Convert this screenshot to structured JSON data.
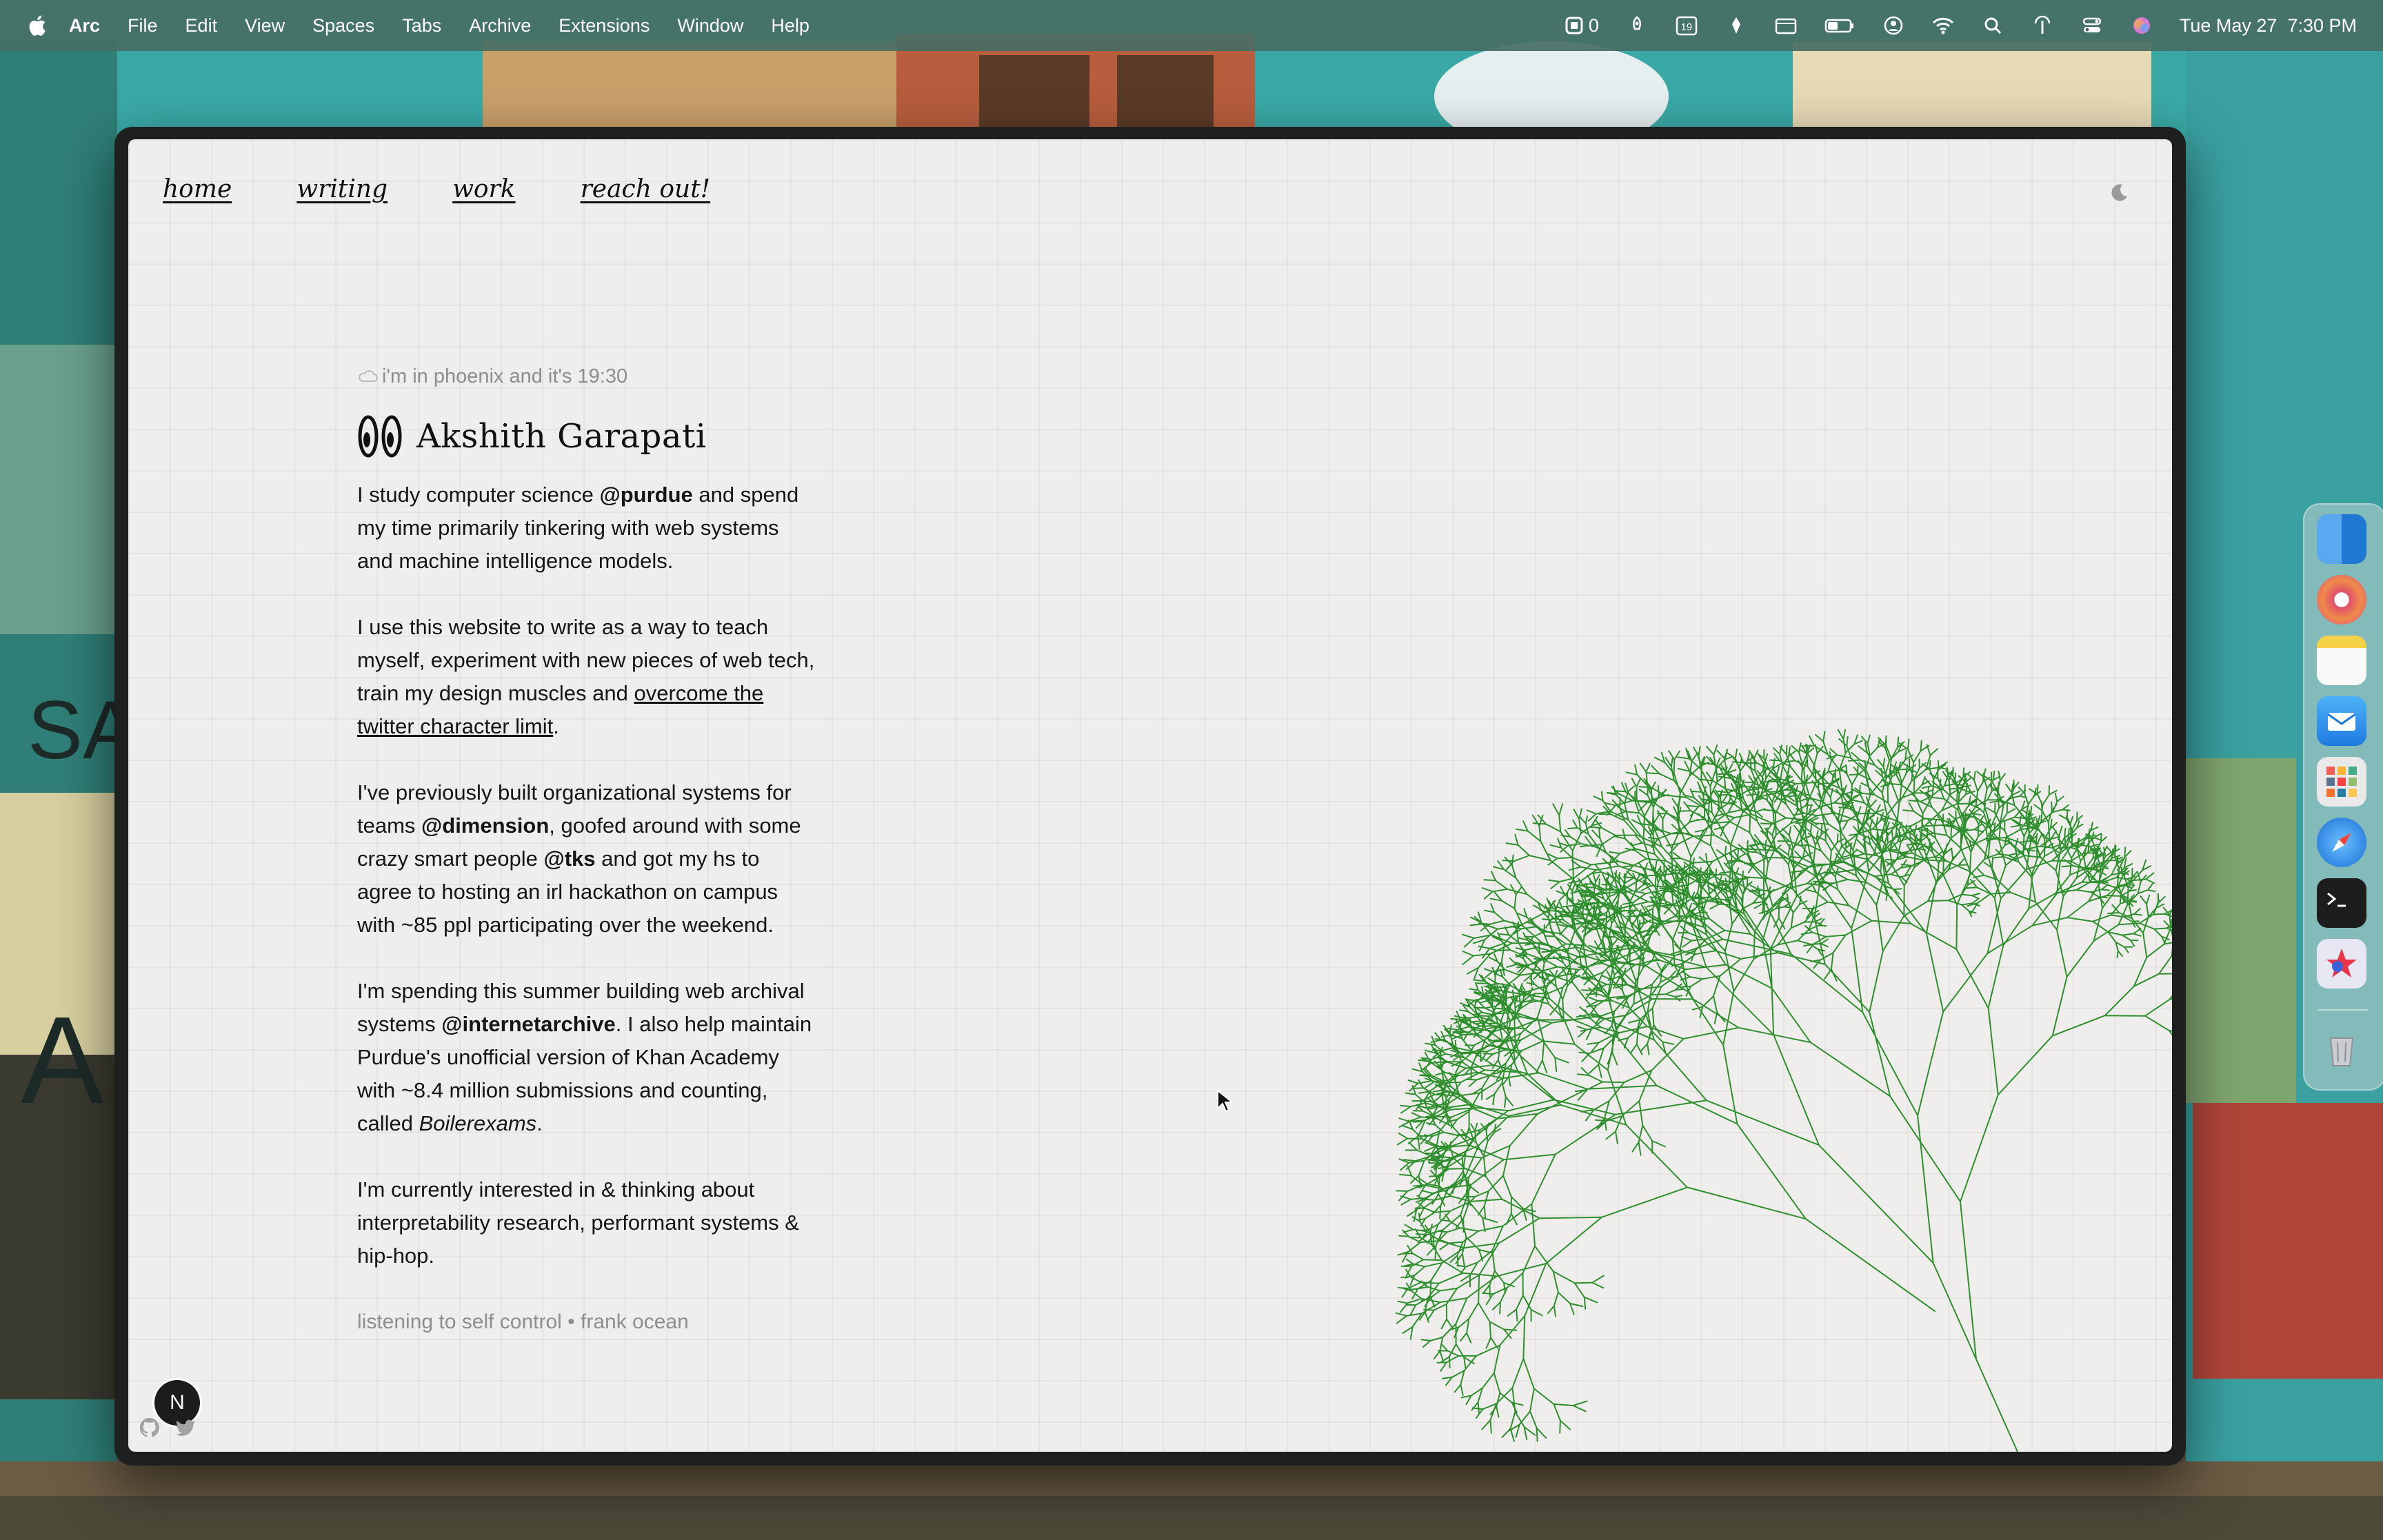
{
  "menubar": {
    "app_name": "Arc",
    "menus": [
      "File",
      "Edit",
      "View",
      "Spaces",
      "Tabs",
      "Archive",
      "Extensions",
      "Window",
      "Help"
    ],
    "status_count": "0",
    "calendar_day": "19",
    "datetime": "Tue May 27  7:30 PM"
  },
  "nav": {
    "home": "home",
    "writing": "writing",
    "work": "work",
    "reach_out": "reach out!"
  },
  "hero": {
    "location_line": "i'm in phoenix and it's 19:30",
    "name": "Akshith Garapati"
  },
  "paragraphs": {
    "p1_a": "I study computer science ",
    "p1_b": "@purdue",
    "p1_c": " and spend my time primarily tinkering with web systems and machine intelligence models.",
    "p2_a": "I use this website to write as a way to teach myself, experiment with new pieces of web tech, train my design muscles and ",
    "p2_link": "overcome the twitter character limit",
    "p2_c": ".",
    "p3_a": "I've previously built organizational systems for teams ",
    "p3_b": "@dimension",
    "p3_c": ", goofed around with some crazy smart people ",
    "p3_d": "@tks",
    "p3_e": " and got my hs to agree to hosting an irl hackathon on campus with ~85 ppl participating over the weekend.",
    "p4_a": "I'm spending this summer building web archival systems ",
    "p4_b": "@internetarchive",
    "p4_c": ". I also help maintain Purdue's unofficial version of Khan Academy with ~8.4 million submissions and counting, called ",
    "p4_d": "Boilerexams",
    "p4_e": ".",
    "p5": "I'm currently interested in & thinking about interpretability research, performant systems & hip-hop."
  },
  "listening": "listening to self control • frank ocean",
  "avatar_letter": "N",
  "colors": {
    "page_bg": "#efeeec",
    "tree_green": "#2f8f2f",
    "menubar_bg": "#466e64"
  },
  "dock_apps": [
    "finder-icon",
    "chrome-icon",
    "notes-icon",
    "mail-icon",
    "launchpad-icon",
    "safari-icon",
    "terminal-icon",
    "raycast-icon",
    "trash-icon"
  ]
}
